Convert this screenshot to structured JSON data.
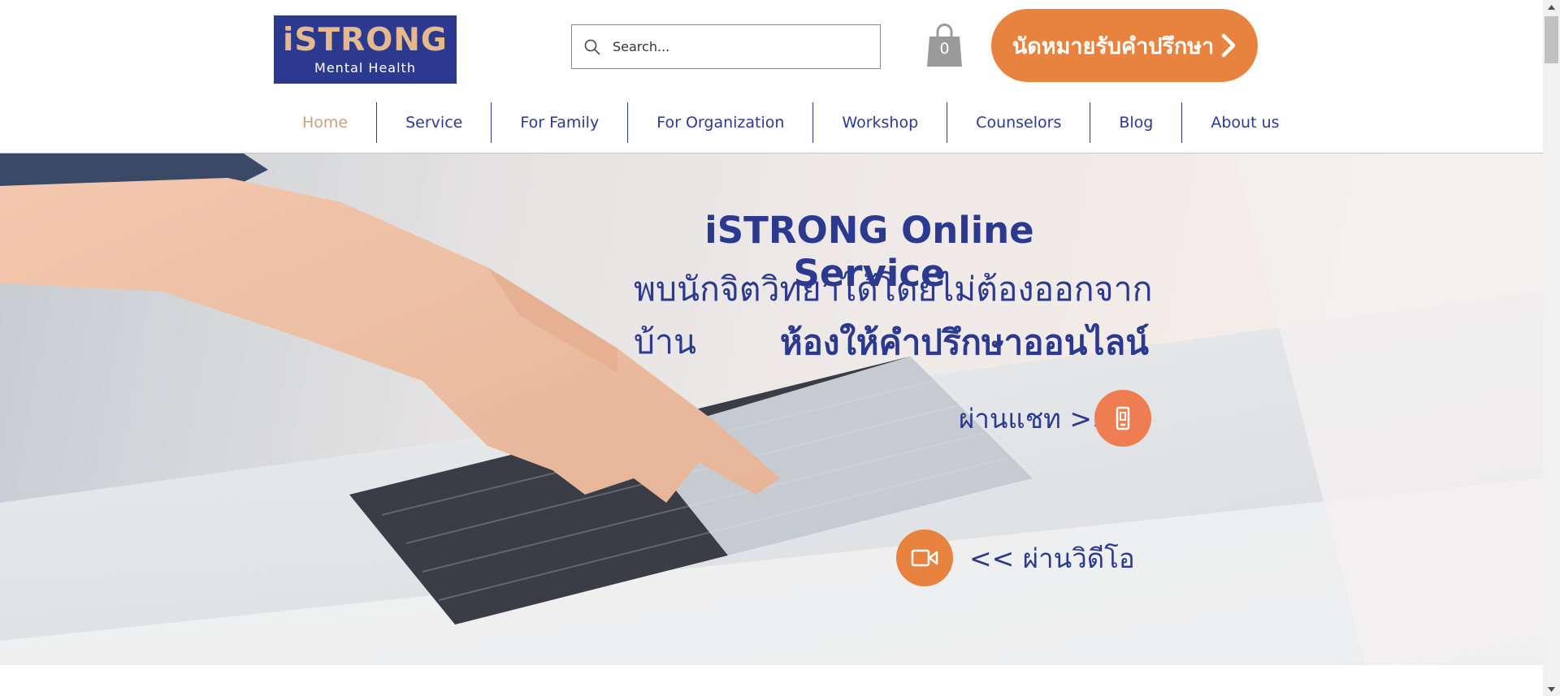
{
  "logo": {
    "title": "iSTRONG",
    "subtitle": "Mental Health"
  },
  "search": {
    "placeholder": "Search..."
  },
  "cart": {
    "count": "0"
  },
  "cta": {
    "label": "นัดหมายรับคำปรึกษา"
  },
  "nav": {
    "items": [
      {
        "label": "Home"
      },
      {
        "label": "Service"
      },
      {
        "label": "For Family"
      },
      {
        "label": "For Organization"
      },
      {
        "label": "Workshop"
      },
      {
        "label": "Counselors"
      },
      {
        "label": "Blog"
      },
      {
        "label": "About us"
      }
    ]
  },
  "hero": {
    "title": "iSTRONG Online Service",
    "subtitle": "พบนักจิตวิทยาได้โดยไม่ต้องออกจากบ้าน",
    "heading": "ห้องให้คำปรึกษาออนไลน์",
    "chat_label": "ผ่านแชท >>",
    "video_label": "<< ผ่านวิดีโอ"
  },
  "colors": {
    "brand_navy": "#2b3a8f",
    "accent_orange": "#e8833f",
    "active_nav": "#c9a27b"
  },
  "icons": {
    "search": "search-icon",
    "cart": "shopping-bag-icon",
    "cta": "chevron-right-icon",
    "chat": "mobile-phone-icon",
    "video": "video-camera-icon"
  }
}
